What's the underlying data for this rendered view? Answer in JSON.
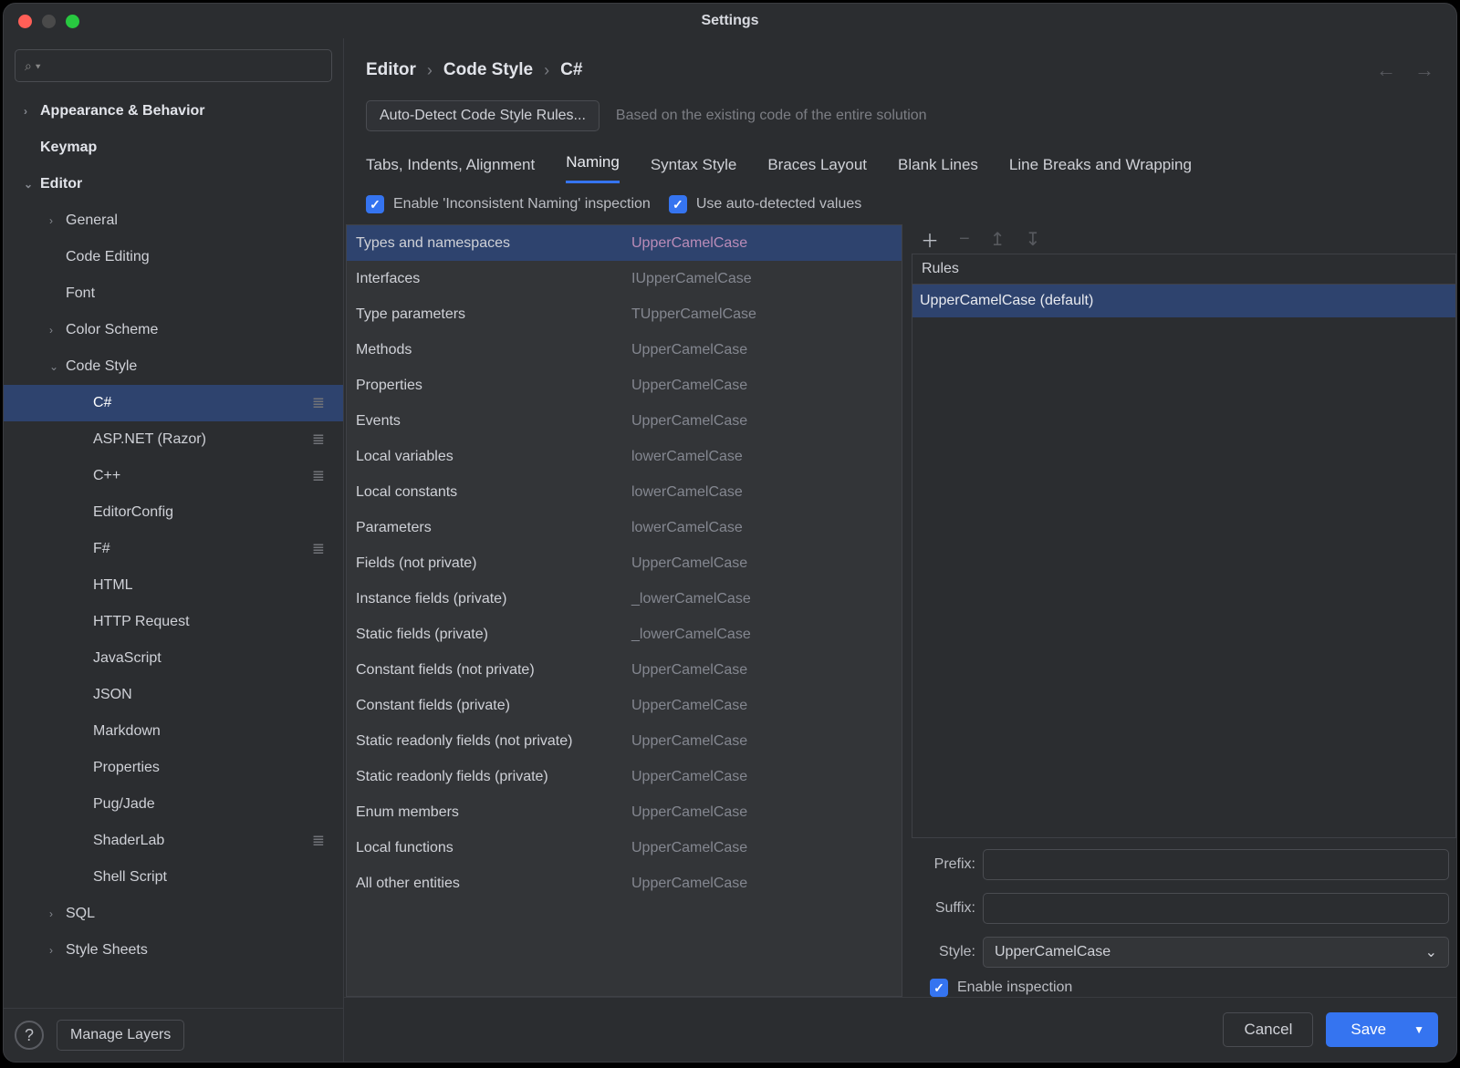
{
  "window": {
    "title": "Settings"
  },
  "search": {
    "icon": "⌕ ▾"
  },
  "tree": {
    "appearance": "Appearance & Behavior",
    "keymap": "Keymap",
    "editor": "Editor",
    "general": "General",
    "code_editing": "Code Editing",
    "font": "Font",
    "color_scheme": "Color Scheme",
    "code_style": "Code Style",
    "cs_csharp": "C#",
    "cs_aspnet": "ASP.NET (Razor)",
    "cs_cpp": "C++",
    "cs_editorconfig": "EditorConfig",
    "cs_fsharp": "F#",
    "cs_html": "HTML",
    "cs_http": "HTTP Request",
    "cs_js": "JavaScript",
    "cs_json": "JSON",
    "cs_md": "Markdown",
    "cs_props": "Properties",
    "cs_pug": "Pug/Jade",
    "cs_shaderlab": "ShaderLab",
    "cs_shell": "Shell Script",
    "cs_sql": "SQL",
    "cs_stylesheets": "Style Sheets"
  },
  "breadcrumb": {
    "editor": "Editor",
    "code_style": "Code Style",
    "csharp": "C#"
  },
  "subheader": {
    "autodetect": "Auto-Detect Code Style Rules...",
    "note": "Based on the existing code of the entire solution"
  },
  "tabs": {
    "tabs_indents": "Tabs, Indents, Alignment",
    "naming": "Naming",
    "syntax": "Syntax Style",
    "braces": "Braces Layout",
    "blank": "Blank Lines",
    "linebreaks": "Line Breaks and Wrapping"
  },
  "checks": {
    "enable_naming": "Enable 'Inconsistent Naming' inspection",
    "use_auto": "Use auto-detected values"
  },
  "naming_rows": [
    {
      "name": "Types and namespaces",
      "style": "UpperCamelCase"
    },
    {
      "name": "Interfaces",
      "style": "IUpperCamelCase"
    },
    {
      "name": "Type parameters",
      "style": "TUpperCamelCase"
    },
    {
      "name": "Methods",
      "style": "UpperCamelCase"
    },
    {
      "name": "Properties",
      "style": "UpperCamelCase"
    },
    {
      "name": "Events",
      "style": "UpperCamelCase"
    },
    {
      "name": "Local variables",
      "style": "lowerCamelCase"
    },
    {
      "name": "Local constants",
      "style": "lowerCamelCase"
    },
    {
      "name": "Parameters",
      "style": "lowerCamelCase"
    },
    {
      "name": "Fields (not private)",
      "style": "UpperCamelCase"
    },
    {
      "name": "Instance fields (private)",
      "style": "_lowerCamelCase"
    },
    {
      "name": "Static fields (private)",
      "style": "_lowerCamelCase"
    },
    {
      "name": "Constant fields (not private)",
      "style": "UpperCamelCase"
    },
    {
      "name": "Constant fields (private)",
      "style": "UpperCamelCase"
    },
    {
      "name": "Static readonly fields (not private)",
      "style": "UpperCamelCase"
    },
    {
      "name": "Static readonly fields (private)",
      "style": "UpperCamelCase"
    },
    {
      "name": "Enum members",
      "style": "UpperCamelCase"
    },
    {
      "name": "Local functions",
      "style": "UpperCamelCase"
    },
    {
      "name": "All other entities",
      "style": "UpperCamelCase"
    }
  ],
  "rules": {
    "header": "Rules",
    "item": "UpperCamelCase (default)",
    "prefix_label": "Prefix:",
    "suffix_label": "Suffix:",
    "style_label": "Style:",
    "style_value": "UpperCamelCase",
    "enable_inspection": "Enable inspection"
  },
  "footer": {
    "help": "?",
    "layers": "Manage Layers",
    "cancel": "Cancel",
    "save": "Save"
  }
}
